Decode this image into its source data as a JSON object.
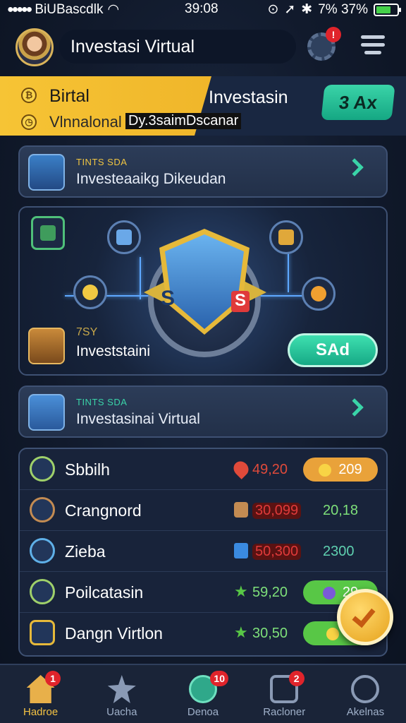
{
  "status_bar": {
    "carrier": "BiUBascdlk",
    "time": "39:08",
    "battery": "7% 37%",
    "battery_level": 0.7
  },
  "header": {
    "title": "Investasi Virtual",
    "notification_badge": "!"
  },
  "banner": {
    "left_line1": "Birtal",
    "left_line2": "Vlnnalonal",
    "left_overlay": "Dy.3saimDscanar",
    "right_title": "Investasin",
    "button_label": "3 Ax"
  },
  "card_top": {
    "subtitle": "TINTS SDA",
    "title": "Investeaaikg Dikeudan"
  },
  "hero": {
    "subtitle": "7SY",
    "title": "Investstaini",
    "button_label": "SAd",
    "shield_text_left": "S",
    "shield_text_right": "S"
  },
  "card_bottom": {
    "subtitle": "TINTS SDA",
    "title": "Investasinai Virtual"
  },
  "list": {
    "rows": [
      {
        "name": "Sbbilh",
        "value": "49,20",
        "value_color": "#e04a3a",
        "chip": "209",
        "chip_color": "#e9a23a",
        "icon_color": "#9fd06a"
      },
      {
        "name": "Crangnord",
        "value": "30,099",
        "value_color": "#e03a3a",
        "chip": "20,18",
        "chip_color": "",
        "icon_color": "#c38b52"
      },
      {
        "name": "Zieba",
        "value": "50,300",
        "value_color": "#e03a3a",
        "chip": "2300",
        "chip_color": "",
        "icon_color": "#5fb0e8"
      },
      {
        "name": "Poilcatasin",
        "value": "59,20",
        "value_color": "#7ee07a",
        "chip": "29",
        "chip_color": "#58c746",
        "icon_color": "#9fd06a"
      },
      {
        "name": "Dangn Virtlon",
        "value": "30,50",
        "value_color": "#7ee07a",
        "chip": "2",
        "chip_color": "#58c746",
        "icon_color": "#e6b93a"
      }
    ]
  },
  "nav": {
    "items": [
      {
        "label": "Hadroe",
        "badge": "1",
        "active": true
      },
      {
        "label": "Uacha",
        "badge": "",
        "active": false
      },
      {
        "label": "Denoa",
        "badge": "10",
        "active": false
      },
      {
        "label": "Racloner",
        "badge": "2",
        "active": false
      },
      {
        "label": "Akelnas",
        "badge": "",
        "active": false
      }
    ]
  },
  "colors": {
    "accent_teal": "#3ad4a8",
    "accent_yellow": "#f6c435",
    "badge_red": "#e0242b"
  }
}
